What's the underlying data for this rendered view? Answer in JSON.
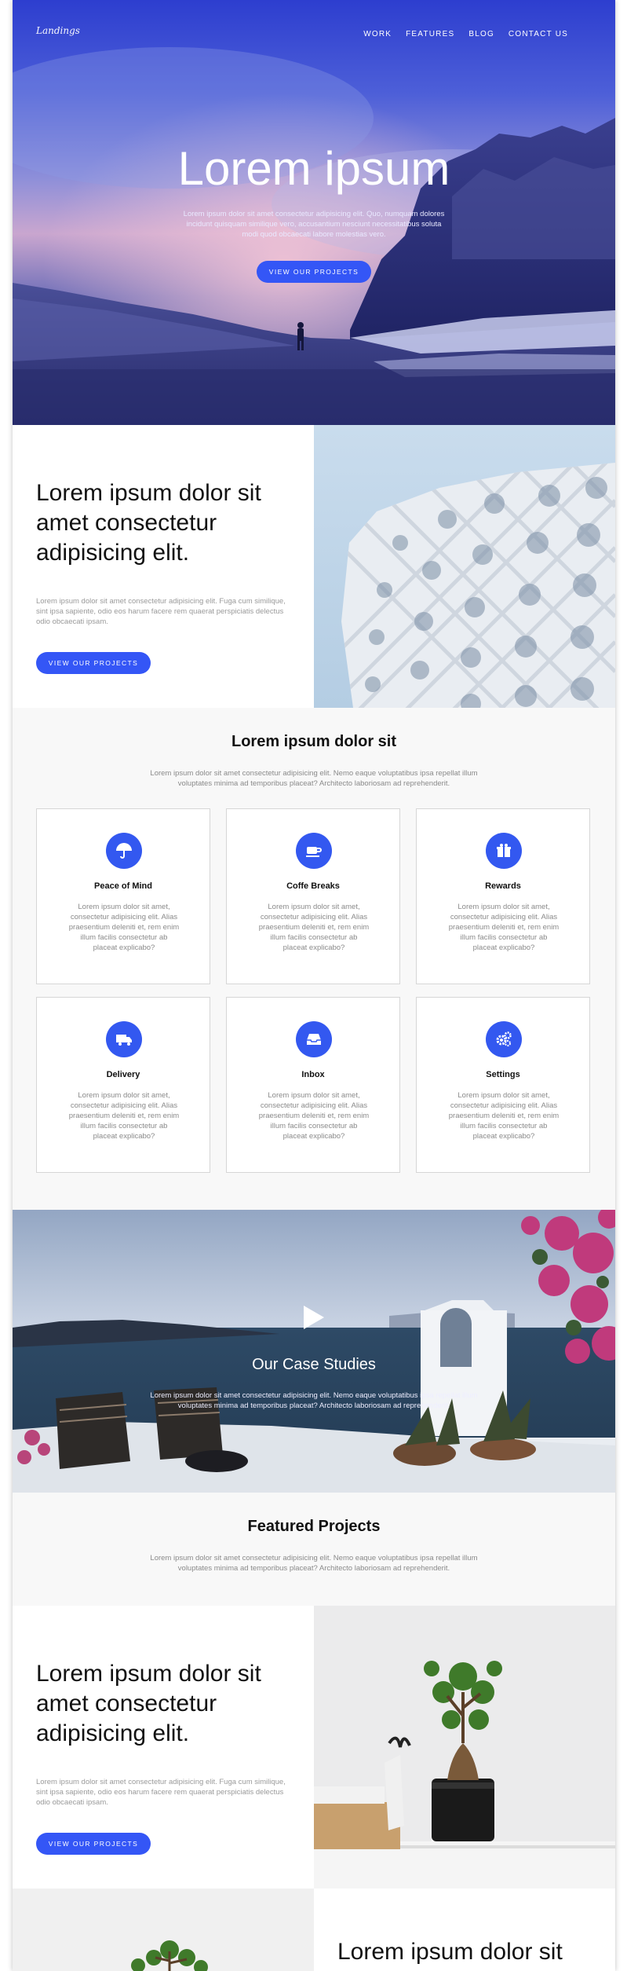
{
  "header": {
    "logo": "Landings",
    "nav": [
      "WORK",
      "FEATURES",
      "BLOG",
      "CONTACT US"
    ]
  },
  "hero": {
    "title": "Lorem ipsum",
    "text": "Lorem ipsum dolor sit amet consectetur adipisicing elit. Quo, numquam dolores incidunt quisquam similique vero, accusantium nesciunt necessitatibus soluta modi quod obcaecati labore molestias vero.",
    "button": "VIEW OUR PROJECTS"
  },
  "intro": {
    "heading": "Lorem ipsum dolor sit amet consectetur adipisicing elit.",
    "text": "Lorem ipsum dolor sit amet consectetur adipisicing elit. Fuga cum similique, sint ipsa sapiente, odio eos harum facere rem quaerat perspiciatis delectus odio obcaecati ipsam.",
    "button": "VIEW OUR PROJECTS"
  },
  "features": {
    "title": "Lorem ipsum dolor sit",
    "description": "Lorem ipsum dolor sit amet consectetur adipisicing elit. Nemo eaque voluptatibus ipsa repellat illum voluptates minima ad temporibus placeat? Architecto laboriosam ad reprehenderit.",
    "items": [
      {
        "title": "Peace of Mind",
        "icon": "umbrella-icon",
        "text": "Lorem ipsum dolor sit amet, consectetur adipisicing elit. Alias praesentium deleniti et, rem enim illum facilis consectetur ab placeat explicabo?"
      },
      {
        "title": "Coffe Breaks",
        "icon": "coffee-icon",
        "text": "Lorem ipsum dolor sit amet, consectetur adipisicing elit. Alias praesentium deleniti et, rem enim illum facilis consectetur ab placeat explicabo?"
      },
      {
        "title": "Rewards",
        "icon": "gift-icon",
        "text": "Lorem ipsum dolor sit amet, consectetur adipisicing elit. Alias praesentium deleniti et, rem enim illum facilis consectetur ab placeat explicabo?"
      },
      {
        "title": "Delivery",
        "icon": "truck-icon",
        "text": "Lorem ipsum dolor sit amet, consectetur adipisicing elit. Alias praesentium deleniti et, rem enim illum facilis consectetur ab placeat explicabo?"
      },
      {
        "title": "Inbox",
        "icon": "inbox-icon",
        "text": "Lorem ipsum dolor sit amet, consectetur adipisicing elit. Alias praesentium deleniti et, rem enim illum facilis consectetur ab placeat explicabo?"
      },
      {
        "title": "Settings",
        "icon": "gears-icon",
        "text": "Lorem ipsum dolor sit amet, consectetur adipisicing elit. Alias praesentium deleniti et, rem enim illum facilis consectetur ab placeat explicabo?"
      }
    ]
  },
  "case_studies": {
    "title": "Our Case Studies",
    "text": "Lorem ipsum dolor sit amet consectetur adipisicing elit. Nemo eaque voluptatibus ipsa repellat illum voluptates minima ad temporibus placeat? Architecto laboriosam ad reprehenderit."
  },
  "featured": {
    "title": "Featured Projects",
    "description": "Lorem ipsum dolor sit amet consectetur adipisicing elit. Nemo eaque voluptatibus ipsa repellat illum voluptates minima ad temporibus placeat? Architecto laboriosam ad reprehenderit."
  },
  "project1": {
    "heading": "Lorem ipsum dolor sit amet consectetur adipisicing elit.",
    "text": "Lorem ipsum dolor sit amet consectetur adipisicing elit. Fuga cum similique, sint ipsa sapiente, odio eos harum facere rem quaerat perspiciatis delectus odio obcaecati ipsam.",
    "button": "VIEW OUR PROJECTS"
  },
  "project2": {
    "heading": "Lorem ipsum dolor sit"
  },
  "colors": {
    "accent": "#3456f6",
    "section_gray": "#f8f8f8"
  }
}
